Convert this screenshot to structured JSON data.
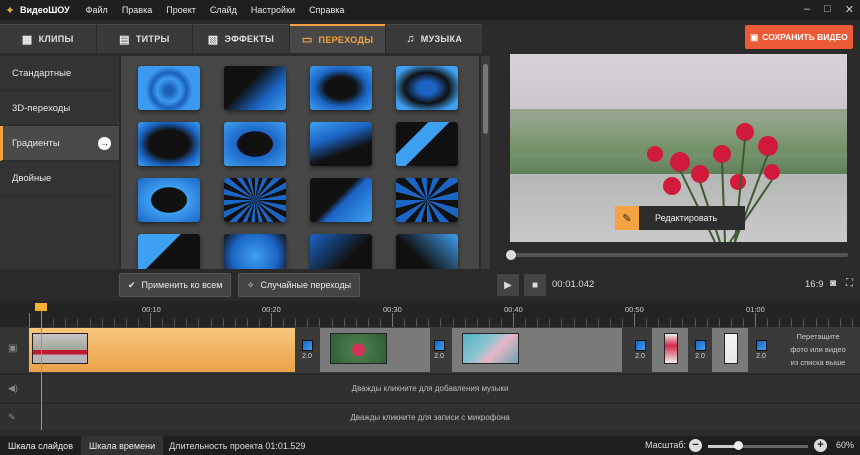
{
  "titlebar": {
    "app_name": "ВидеоШОУ",
    "menu": [
      "Файл",
      "Правка",
      "Проект",
      "Слайд",
      "Настройки",
      "Справка"
    ]
  },
  "tabs": [
    {
      "label": "КЛИПЫ",
      "icon": "film-icon"
    },
    {
      "label": "ТИТРЫ",
      "icon": "text-icon"
    },
    {
      "label": "ЭФФЕКТЫ",
      "icon": "effects-icon"
    },
    {
      "label": "ПЕРЕХОДЫ",
      "icon": "transitions-icon",
      "active": true
    },
    {
      "label": "МУЗЫКА",
      "icon": "music-note-icon"
    }
  ],
  "save_button": "СОХРАНИТЬ ВИДЕО",
  "categories": [
    {
      "label": "Стандартные"
    },
    {
      "label": "3D-переходы"
    },
    {
      "label": "Градиенты",
      "active": true
    },
    {
      "label": "Двойные"
    }
  ],
  "edit_button": "Редактировать",
  "actions": {
    "apply_all": "Применить ко всем",
    "random": "Случайные переходы"
  },
  "player": {
    "time": "00:01.042",
    "ratio": "16:9"
  },
  "ruler": {
    "labels": [
      "00:10",
      "00:20",
      "00:30",
      "00:40",
      "00:50",
      "01:00"
    ]
  },
  "timeline": {
    "transition_durations": [
      "2.0",
      "2.0",
      "2.0",
      "2.0",
      "2.0",
      "2.0"
    ],
    "drop_hint": [
      "Перетащите",
      "фото или видео",
      "из списка выше"
    ],
    "music_lane": "Дважды кликните для добавления музыки",
    "mic_lane": "Дважды кликните для записи с микрофона"
  },
  "statusbar": {
    "tab_slides": "Шкала слайдов",
    "tab_timeline": "Шкала времени",
    "duration": "Длительность проекта 01:01.529",
    "zoom_label": "Масштаб:",
    "zoom_percent": "60%"
  },
  "colors": {
    "accent": "#f5a341",
    "save": "#ec5a36",
    "transition_blue": "#1b65c6"
  }
}
